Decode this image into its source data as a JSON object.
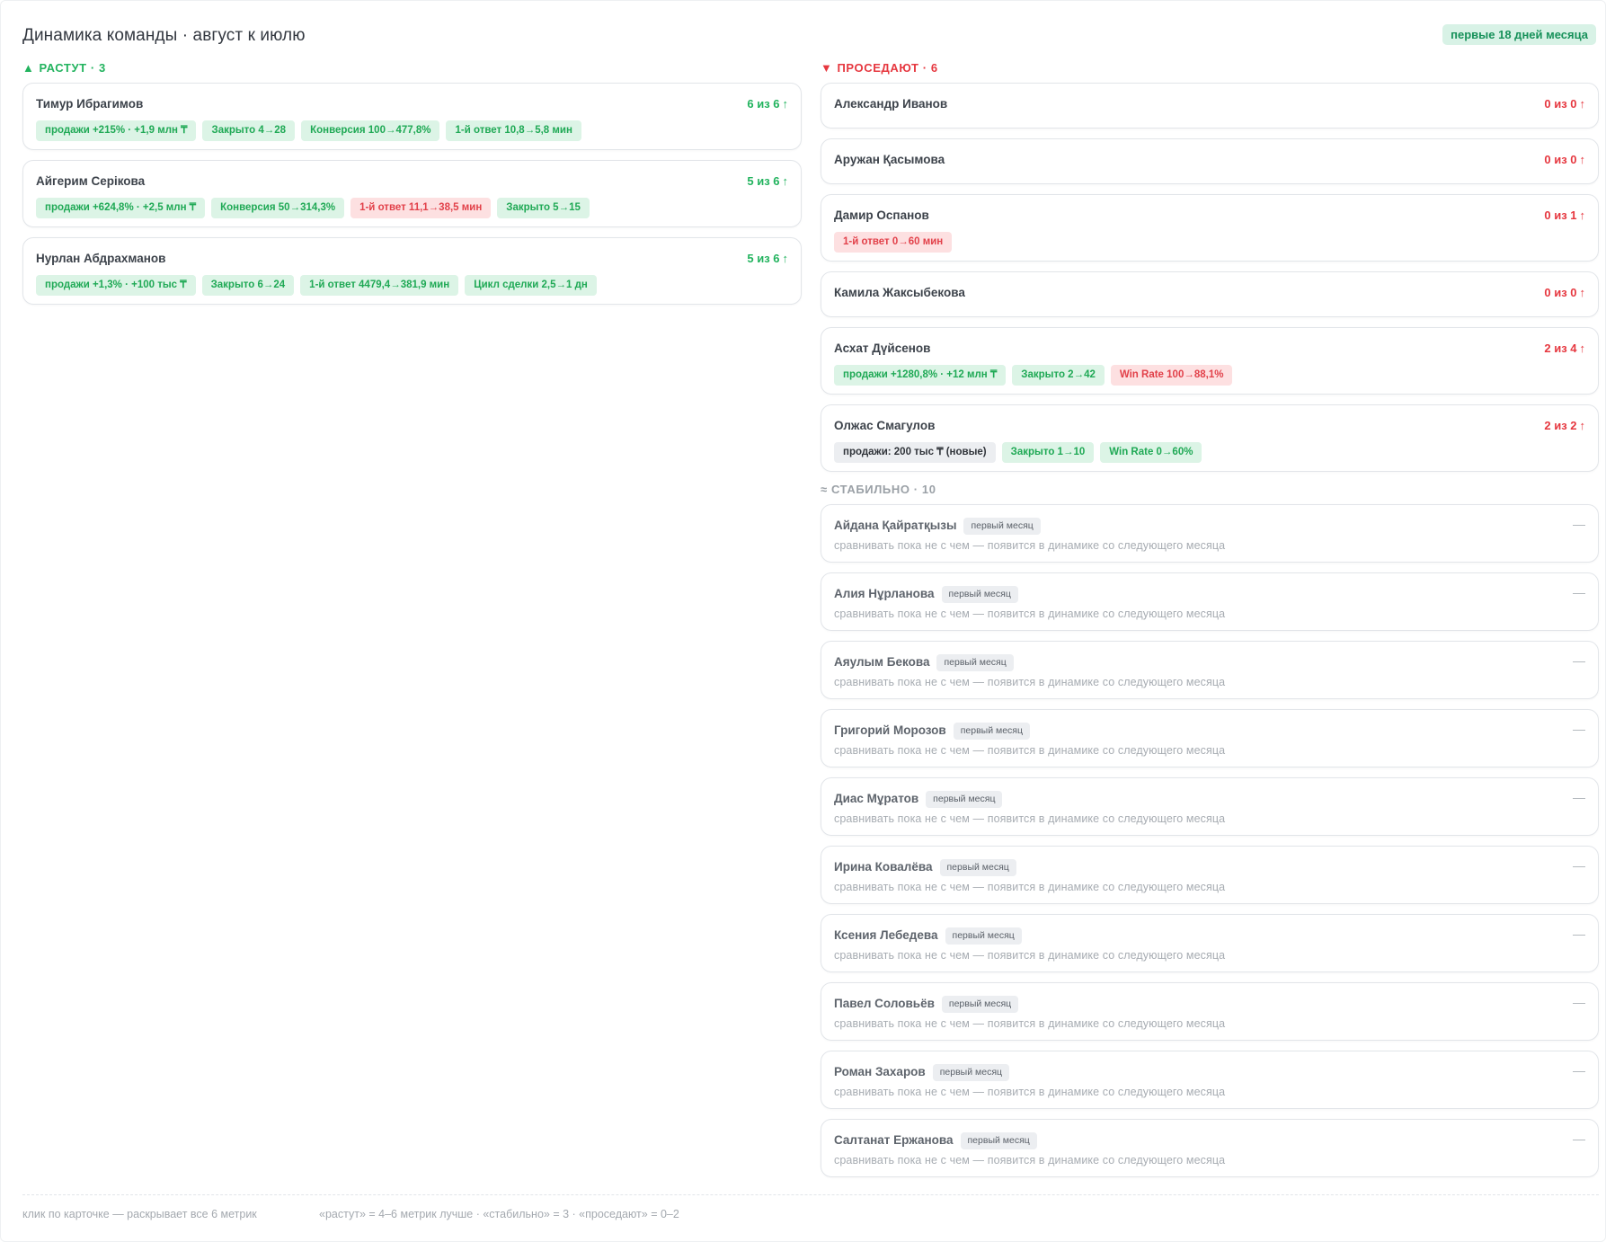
{
  "header": {
    "title": "Динамика команды · август к июлю",
    "period_badge": "первые 18 дней месяца"
  },
  "colors": {
    "up": "#22b35e",
    "down": "#e6373f",
    "tag_green_bg": "#dcf4e6",
    "tag_red_bg": "#fde0e1",
    "tag_neutral_bg": "#eceef1"
  },
  "growing": {
    "arrow": "▲",
    "title": "РАСТУТ · 3",
    "cards": [
      {
        "name": "Тимур Ибрагимов",
        "score": "6 из 6",
        "arrow": "↑",
        "tags": [
          {
            "text": "продажи +215% · +1,9 млн ₸",
            "tone": "g"
          },
          {
            "text": "Закрыто 4→28",
            "tone": "g"
          },
          {
            "text": "Конверсия 100→477,8%",
            "tone": "g"
          },
          {
            "text": "1-й ответ 10,8→5,8 мин",
            "tone": "g"
          }
        ]
      },
      {
        "name": "Айгерим Серікова",
        "score": "5 из 6",
        "arrow": "↑",
        "tags": [
          {
            "text": "продажи +624,8% · +2,5 млн ₸",
            "tone": "g"
          },
          {
            "text": "Конверсия 50→314,3%",
            "tone": "g"
          },
          {
            "text": "1-й ответ 11,1→38,5 мин",
            "tone": "r"
          },
          {
            "text": "Закрыто 5→15",
            "tone": "g"
          }
        ]
      },
      {
        "name": "Нурлан Абдрахманов",
        "score": "5 из 6",
        "arrow": "↑",
        "tags": [
          {
            "text": "продажи +1,3% · +100 тыс ₸",
            "tone": "g"
          },
          {
            "text": "Закрыто 6→24",
            "tone": "g"
          },
          {
            "text": "1-й ответ 4479,4→381,9 мин",
            "tone": "g"
          },
          {
            "text": "Цикл сделки 2,5→1 дн",
            "tone": "g"
          }
        ]
      }
    ]
  },
  "declining": {
    "arrow": "▼",
    "title": "ПРОСЕДАЮТ · 6",
    "cards": [
      {
        "name": "Александр Иванов",
        "score": "0 из 0",
        "arrow": "↑",
        "tags": []
      },
      {
        "name": "Аружан Қасымова",
        "score": "0 из 0",
        "arrow": "↑",
        "tags": []
      },
      {
        "name": "Дамир Оспанов",
        "score": "0 из 1",
        "arrow": "↑",
        "tags": [
          {
            "text": "1-й ответ 0→60 мин",
            "tone": "r"
          }
        ]
      },
      {
        "name": "Камила Жаксыбекова",
        "score": "0 из 0",
        "arrow": "↑",
        "tags": []
      },
      {
        "name": "Асхат Дүйсенов",
        "score": "2 из 4",
        "arrow": "↑",
        "tags": [
          {
            "text": "продажи +1280,8% · +12 млн ₸",
            "tone": "g"
          },
          {
            "text": "Закрыто 2→42",
            "tone": "g"
          },
          {
            "text": "Win Rate 100→88,1%",
            "tone": "r"
          }
        ]
      },
      {
        "name": "Олжас Смагулов",
        "score": "2 из 2",
        "arrow": "↑",
        "tags": [
          {
            "text": "продажи: 200 тыс ₸ (новые)",
            "tone": "n"
          },
          {
            "text": "Закрыто 1→10",
            "tone": "g"
          },
          {
            "text": "Win Rate 0→60%",
            "tone": "g"
          }
        ]
      }
    ]
  },
  "stable": {
    "title": "≈ СТАБИЛЬНО · 10",
    "badge": "первый месяц",
    "note": "сравнивать пока не с чем — появится в динамике со следующего месяца",
    "dash": "—",
    "names": [
      "Айдана Қайратқызы",
      "Алия Нұрланова",
      "Аяулым Бекова",
      "Григорий Морозов",
      "Диас Мұратов",
      "Ирина Ковалёва",
      "Ксения Лебедева",
      "Павел Соловьёв",
      "Роман Захаров",
      "Салтанат Ержанова"
    ]
  },
  "footer": {
    "hint": "клик по карточке — раскрывает все 6 метрик",
    "legend": "«растут» = 4–6 метрик лучше · «стабильно» = 3 · «проседают» = 0–2"
  }
}
